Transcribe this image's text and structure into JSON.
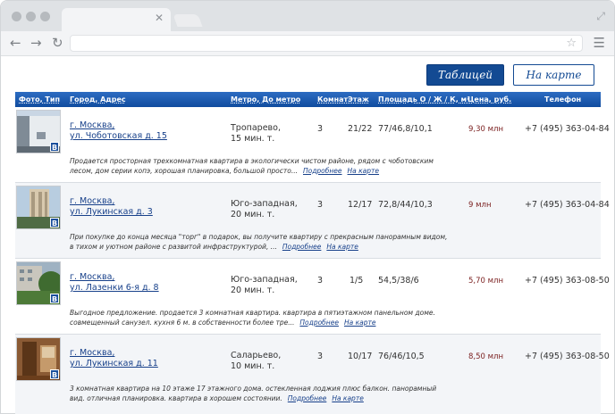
{
  "header": {
    "view_table": "Таблицей",
    "view_map": "На карте"
  },
  "columns": {
    "photo": "Фото, Тип",
    "address": "Город, Адрес",
    "metro": "Метро, До метро",
    "rooms": "Комнат",
    "floor": "Этаж",
    "area": "Площадь О / Ж / К, м²",
    "price": "Цена, руб.",
    "phone": "Телефон"
  },
  "listings": [
    {
      "badge": "B",
      "city": "г. Москва,",
      "street": "ул. Чоботовская д. 15",
      "metro": "Тропарево,",
      "metro_time": "15 мин. т.",
      "rooms": "3",
      "floor": "21/22",
      "area": "77/46,8/10,1",
      "price": "9,30 млн",
      "phone": "+7 (495) 363-04-84",
      "desc1": "Продается просторная трехкомнатная квартира в экологически чистом районе, рядом с чоботовским",
      "desc2": "лесом, дом серии копэ, хорошая планировка, большой просто...",
      "more": "Подробнее",
      "map": "На карте"
    },
    {
      "badge": "B",
      "city": "г. Москва,",
      "street": "ул. Лукинская д. 3",
      "metro": "Юго-западная,",
      "metro_time": "20 мин. т.",
      "rooms": "3",
      "floor": "12/17",
      "area": "72,8/44/10,3",
      "price": "9 млн",
      "phone": "+7 (495) 363-04-84",
      "desc1": "При покупке до конца месяца \"торг\" в подарок, вы получите квартиру с прекрасным панорамным видом,",
      "desc2": "в тихом и уютном районе с развитой инфраструктурой, ...",
      "more": "Подробнее",
      "map": "На карте"
    },
    {
      "badge": "B",
      "city": "г. Москва,",
      "street": "ул. Лазенки 6-я д. 8",
      "metro": "Юго-западная,",
      "metro_time": "20 мин. т.",
      "rooms": "3",
      "floor": "1/5",
      "area": "54,5/38/6",
      "price": "5,70 млн",
      "phone": "+7 (495) 363-08-50",
      "desc1": "Выгодное предложение. продается 3 комнатная квартира. квартира в пятиэтажном панельном доме.",
      "desc2": "совмещенный санузел. кухня 6 м. в собственности более тре...",
      "more": "Подробнее",
      "map": "На карте"
    },
    {
      "badge": "B",
      "city": "г. Москва,",
      "street": "ул. Лукинская д. 11",
      "metro": "Саларьево,",
      "metro_time": "10 мин. т.",
      "rooms": "3",
      "floor": "10/17",
      "area": "76/46/10,5",
      "price": "8,50 млн",
      "phone": "+7 (495) 363-08-50",
      "desc1": "3 комнатная квартира на 10 этаже 17 этажного дома. остекленная лоджия плюс балкон. панорамный",
      "desc2": "вид. отличная планировка. квартира в хорошем состоянии.",
      "more": "Подробнее",
      "map": "На карте"
    }
  ],
  "colors": {
    "accent": "#134a93",
    "header_bar": "#104c9f",
    "link": "#17408a",
    "price": "#7a1f1f"
  }
}
